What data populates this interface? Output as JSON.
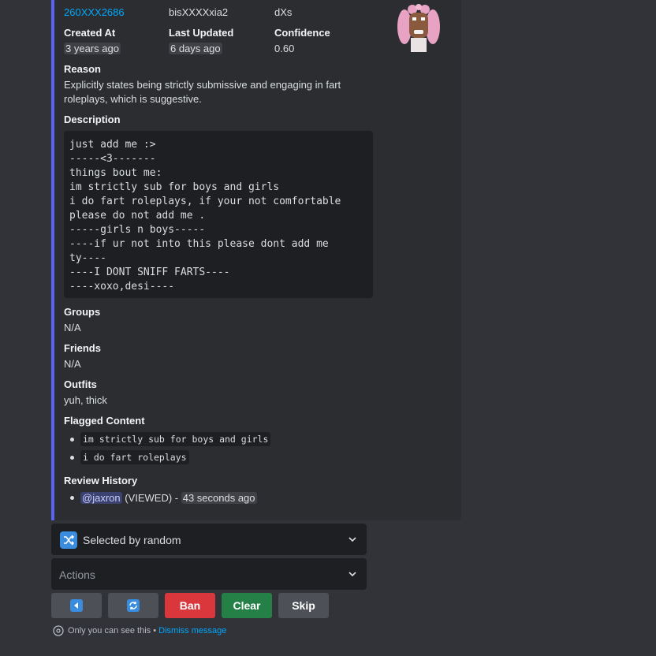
{
  "fields": {
    "user_id": "260XXX2686",
    "username": "bisXXXXxia2",
    "display_name": "dXs",
    "created_at_label": "Created At",
    "created_at_value": "3 years ago",
    "last_updated_label": "Last Updated",
    "last_updated_value": "6 days ago",
    "confidence_label": "Confidence",
    "confidence_value": "0.60"
  },
  "reason": {
    "label": "Reason",
    "line1": "Explicitly states being strictly submissive and engaging in fart",
    "line2": "roleplays, which is suggestive."
  },
  "description": {
    "label": "Description",
    "text": "just add me :>\n-----<3-------\nthings bout me:\nim strictly sub for boys and girls\ni do fart roleplays, if your not comfortable\nplease do not add me .\n-----girls n boys-----\n----if ur not into this please dont add me\nty----\n----I DONT SNIFF FARTS----\n----xoxo,desi----"
  },
  "groups": {
    "label": "Groups",
    "value": "N/A"
  },
  "friends": {
    "label": "Friends",
    "value": "N/A"
  },
  "outfits": {
    "label": "Outfits",
    "value": "yuh, thick"
  },
  "flagged": {
    "label": "Flagged Content",
    "items": [
      "im strictly sub for boys and girls",
      "i do fart roleplays"
    ]
  },
  "history": {
    "label": "Review History",
    "mention": "@jaxron",
    "action": " (VIEWED) - ",
    "time": "43 seconds ago"
  },
  "selects": {
    "sort_selected": "Selected by random",
    "actions_placeholder": "Actions"
  },
  "buttons": {
    "ban": "Ban",
    "clear": "Clear",
    "skip": "Skip"
  },
  "footer": {
    "notice": "Only you can see this • ",
    "dismiss": "Dismiss message"
  },
  "colors": {
    "ban": "#da373c",
    "clear": "#248046",
    "secondary": "#4e5058",
    "accent": "#5865f2"
  },
  "icons": {
    "prev": "prev-arrow-icon",
    "refresh": "refresh-icon",
    "shuffle": "shuffle-icon",
    "eye": "eye-icon"
  }
}
